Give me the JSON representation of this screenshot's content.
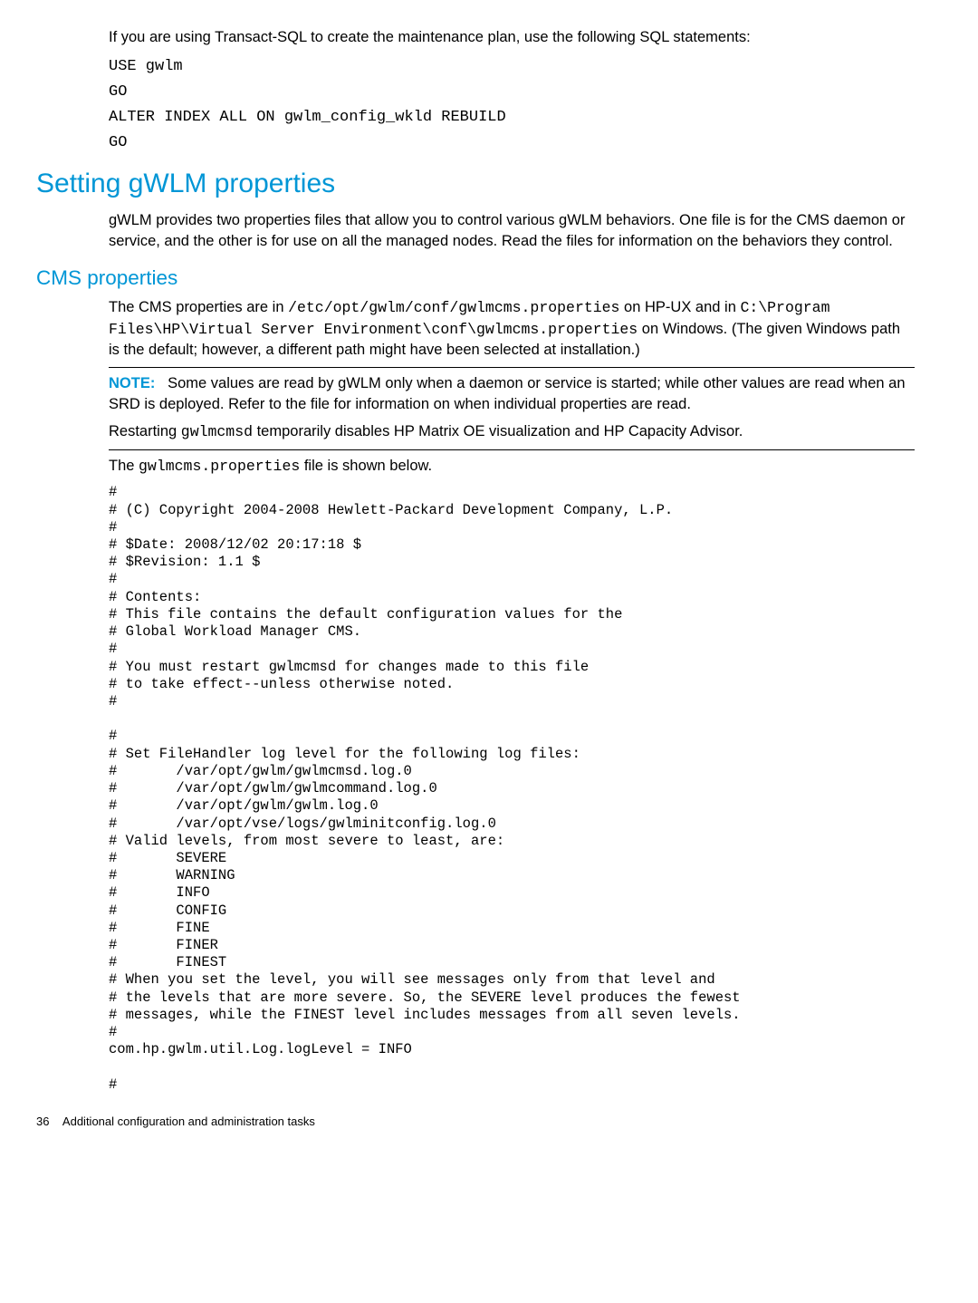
{
  "intro": {
    "transact_text": "If you are using Transact-SQL to create the maintenance plan, use the following SQL statements:",
    "code": "USE gwlm\nGO\nALTER INDEX ALL ON gwlm_config_wkld REBUILD\nGO"
  },
  "section": {
    "title": "Setting gWLM properties",
    "para": "gWLM provides two properties files that allow you to control various gWLM behaviors. One file is for the CMS daemon or service, and the other is for use on all the managed nodes. Read the files for information on the behaviors they control."
  },
  "cms": {
    "title": "CMS properties",
    "p1a": "The CMS properties are in ",
    "p1_code1": "/etc/opt/gwlm/conf/gwlmcms.properties",
    "p1b": " on HP-UX and in ",
    "p1_code2": "C:\\Program Files\\HP\\Virtual Server Environment\\conf\\gwlmcms.properties",
    "p1c": " on Windows. (The given Windows path is the default; however, a different path might have been selected at installation.)",
    "note_label": "NOTE:",
    "note_body1": "   Some values are read by gWLM only when a daemon or service is started; while other values are read when an SRD is deployed. Refer to the file for information on when individual properties are read.",
    "note_body2a": "Restarting ",
    "note_body2_code": "gwlmcmsd",
    "note_body2b": " temporarily disables HP Matrix OE visualization and HP Capacity Advisor.",
    "p2a": "The ",
    "p2_code": "gwlmcms.properties",
    "p2b": " file is shown below.",
    "file": "#\n# (C) Copyright 2004-2008 Hewlett-Packard Development Company, L.P.\n#\n# $Date: 2008/12/02 20:17:18 $\n# $Revision: 1.1 $\n#\n# Contents:\n# This file contains the default configuration values for the\n# Global Workload Manager CMS.\n#\n# You must restart gwlmcmsd for changes made to this file\n# to take effect--unless otherwise noted.\n#\n\n#\n# Set FileHandler log level for the following log files:\n#       /var/opt/gwlm/gwlmcmsd.log.0\n#       /var/opt/gwlm/gwlmcommand.log.0\n#       /var/opt/gwlm/gwlm.log.0\n#       /var/opt/vse/logs/gwlminitconfig.log.0\n# Valid levels, from most severe to least, are:\n#       SEVERE\n#       WARNING\n#       INFO\n#       CONFIG\n#       FINE\n#       FINER\n#       FINEST\n# When you set the level, you will see messages only from that level and\n# the levels that are more severe. So, the SEVERE level produces the fewest\n# messages, while the FINEST level includes messages from all seven levels.\n#\ncom.hp.gwlm.util.Log.logLevel = INFO\n\n#"
  },
  "footer": {
    "page": "36",
    "chapter": "Additional configuration and administration tasks"
  }
}
